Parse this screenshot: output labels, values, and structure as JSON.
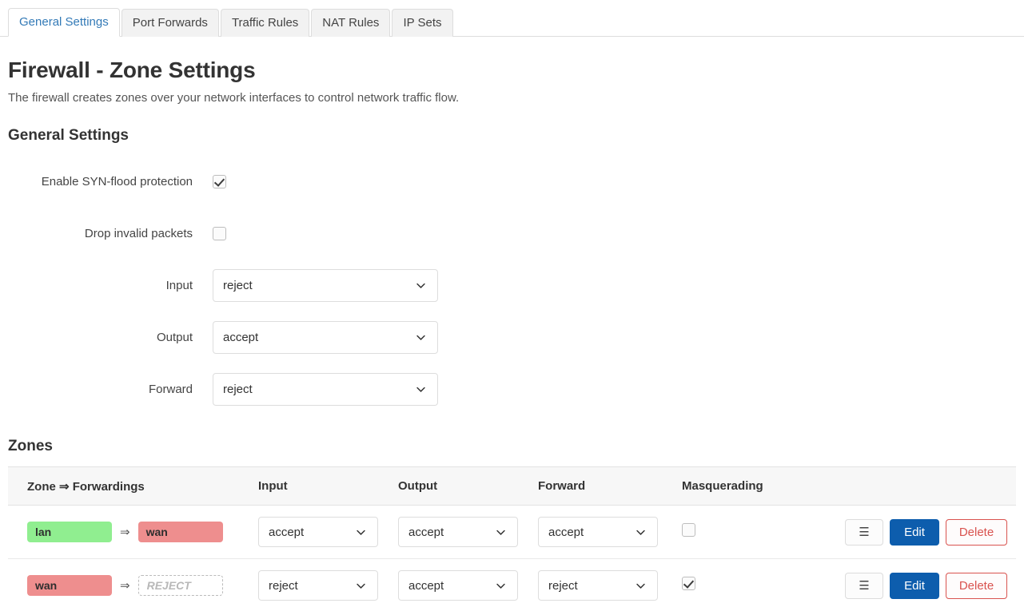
{
  "tabs": [
    {
      "label": "General Settings",
      "active": true
    },
    {
      "label": "Port Forwards",
      "active": false
    },
    {
      "label": "Traffic Rules",
      "active": false
    },
    {
      "label": "NAT Rules",
      "active": false
    },
    {
      "label": "IP Sets",
      "active": false
    }
  ],
  "page": {
    "title": "Firewall - Zone Settings",
    "description": "The firewall creates zones over your network interfaces to control network traffic flow.",
    "section_title": "General Settings",
    "zones_title": "Zones"
  },
  "general": {
    "syn_flood": {
      "label": "Enable SYN-flood protection",
      "checked": true
    },
    "drop_invalid": {
      "label": "Drop invalid packets",
      "checked": false
    },
    "input": {
      "label": "Input",
      "value": "reject"
    },
    "output": {
      "label": "Output",
      "value": "accept"
    },
    "forward": {
      "label": "Forward",
      "value": "reject"
    }
  },
  "zones_table": {
    "headers": {
      "zone": "Zone ⇒ Forwardings",
      "input": "Input",
      "output": "Output",
      "forward": "Forward",
      "masquerading": "Masquerading"
    },
    "arrow_glyph": "⇒",
    "rows": [
      {
        "source": {
          "name": "lan",
          "color": "green"
        },
        "dest": {
          "name": "wan",
          "color": "red"
        },
        "input": "accept",
        "output": "accept",
        "forward": "accept",
        "masquerading": false,
        "menu_label": "☰",
        "edit_label": "Edit",
        "delete_label": "Delete"
      },
      {
        "source": {
          "name": "wan",
          "color": "red"
        },
        "dest": {
          "name": "REJECT",
          "color": "empty"
        },
        "input": "reject",
        "output": "accept",
        "forward": "reject",
        "masquerading": true,
        "menu_label": "☰",
        "edit_label": "Edit",
        "delete_label": "Delete"
      }
    ]
  },
  "colors": {
    "accent_blue": "#0d5dad",
    "danger_red": "#d9534f",
    "zone_green": "#90ee90",
    "zone_red": "#ee8e8e",
    "active_tab_text": "#337ab7"
  }
}
